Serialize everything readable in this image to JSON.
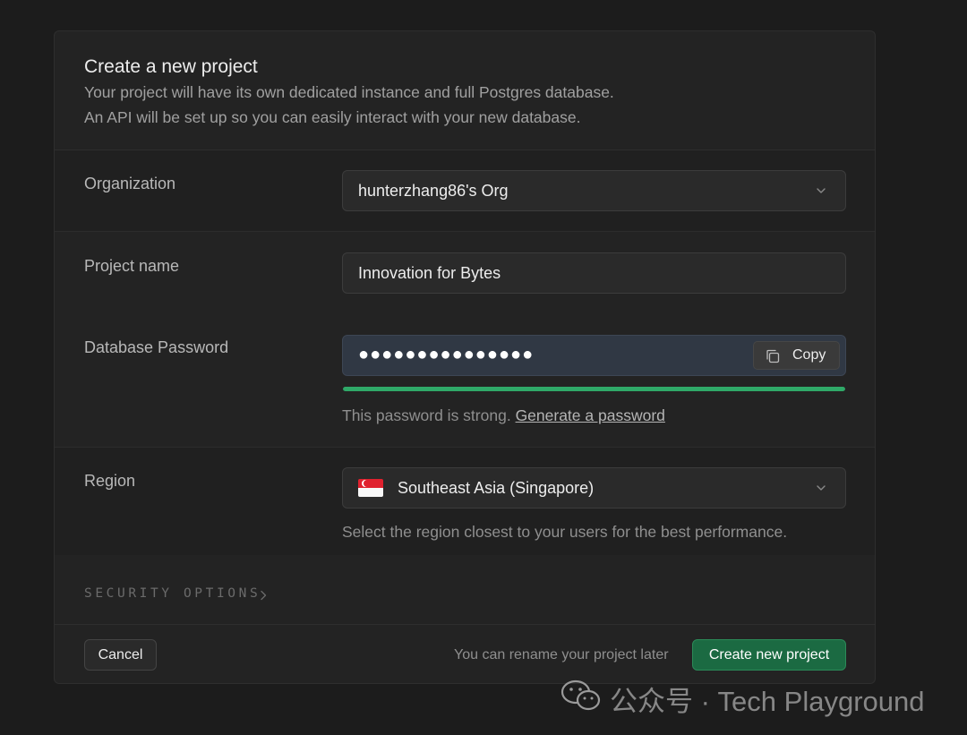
{
  "dialog": {
    "title": "Create a new project",
    "subtitle_line1": "Your project will have its own dedicated instance and full Postgres database.",
    "subtitle_line2": "An API will be set up so you can easily interact with your new database."
  },
  "organization": {
    "label": "Organization",
    "value": "hunterzhang86's Org",
    "icon": "chevron-down-icon"
  },
  "project_name": {
    "label": "Project name",
    "value": "Innovation for Bytes"
  },
  "database_password": {
    "label": "Database Password",
    "masked_value": "●●●●●●●●●●●●●●●",
    "copy_label": "Copy",
    "copy_icon": "copy-icon",
    "strength_fraction": 1.0,
    "strength_color": "#2fa968",
    "helper_text": "This password is strong.",
    "generate_link": "Generate a password"
  },
  "region": {
    "label": "Region",
    "value": "Southeast Asia (Singapore)",
    "flag_icon": "singapore-flag-icon",
    "helper_text": "Select the region closest to your users for the best performance."
  },
  "security_options": {
    "label": "SECURITY OPTIONS",
    "icon": "chevron-right-icon"
  },
  "footer": {
    "cancel_label": "Cancel",
    "note": "You can rename your project later",
    "create_label": "Create new project",
    "create_color": "#1b6a42"
  },
  "watermark": {
    "text": "公众号 · Tech Playground",
    "icon": "wechat-icon"
  }
}
